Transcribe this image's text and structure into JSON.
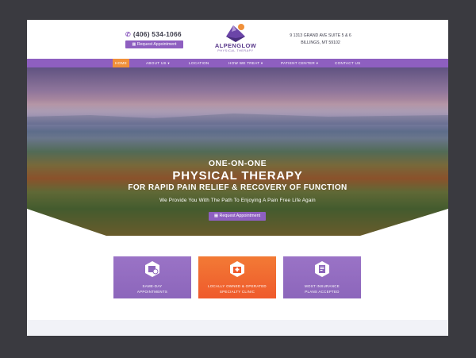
{
  "header": {
    "phone": "(406) 534-1066",
    "request_button": "Request Appointment",
    "logo_name": "ALPENGLOW",
    "logo_sub": "PHYSICAL THERAPY",
    "address_line1": "9 1313 GRAND AVE SUITE 5 & 6",
    "address_line2": "BILLINGS, MT 59102"
  },
  "nav": {
    "items": [
      {
        "label": "HOME",
        "active": true
      },
      {
        "label": "ABOUT US ▾",
        "active": false
      },
      {
        "label": "LOCATION",
        "active": false
      },
      {
        "label": "HOW WE TREAT ▾",
        "active": false
      },
      {
        "label": "PATIENT CENTER ▾",
        "active": false
      },
      {
        "label": "CONTACT US",
        "active": false
      }
    ]
  },
  "hero": {
    "line1": "ONE-ON-ONE",
    "line2": "PHYSICAL THERAPY",
    "line3": "FOR RAPID PAIN RELIEF & RECOVERY OF FUNCTION",
    "line4": "We Provide You With The Path To Enjoying A Pain Free Life Again",
    "button": "Request Appointment"
  },
  "features": {
    "cards": [
      {
        "label1": "SAME-DAY",
        "label2": "APPOINTMENTS",
        "icon": "calendar-clock-icon",
        "color": "purple"
      },
      {
        "label1": "LOCALLY OWNED & OPERATED",
        "label2": "SPECIALTY CLINIC",
        "icon": "clinic-icon",
        "color": "orange"
      },
      {
        "label1": "MOST INSURANCE",
        "label2": "PLANS ACCEPTED",
        "icon": "insurance-document-icon",
        "color": "purple"
      }
    ]
  },
  "colors": {
    "brand_purple": "#8e5fc0",
    "accent_orange": "#f0903a",
    "page_bg": "#3a3a40"
  }
}
